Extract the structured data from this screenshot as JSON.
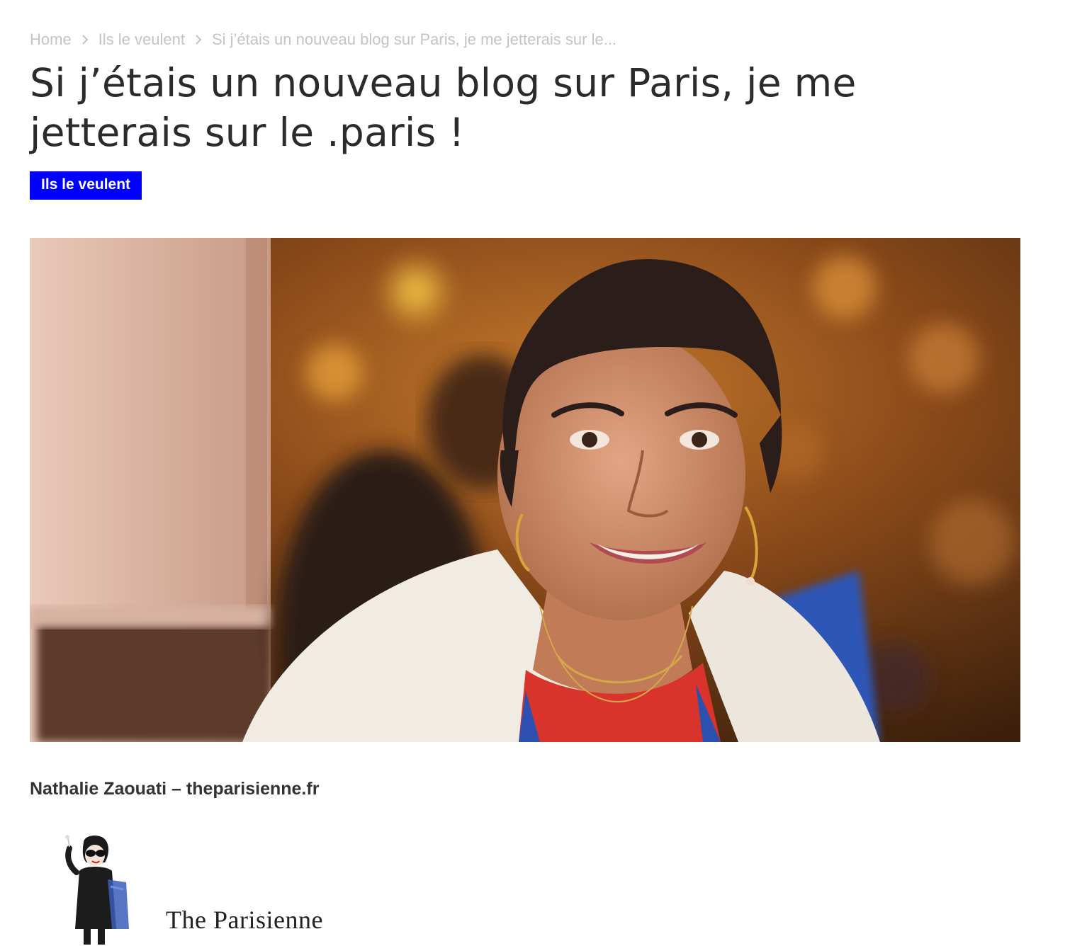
{
  "breadcrumb": {
    "home": "Home",
    "category": "Ils le veulent",
    "current": "Si j’étais un nouveau blog sur Paris, je me jetterais sur le..."
  },
  "article": {
    "title": "Si j’étais un nouveau blog sur Paris, je me jetterais sur le .paris !",
    "category_badge": "Ils le veulent",
    "caption": "Nathalie Zaouati – theparisienne.fr"
  },
  "logo": {
    "text": "The Parisienne"
  },
  "icons": {
    "breadcrumb_separator": "chevron-right-icon"
  },
  "colors": {
    "badge_background": "#0000ff",
    "badge_text": "#ffffff",
    "breadcrumb_text": "#c4c4c4",
    "title_text": "#2b2b2b"
  }
}
